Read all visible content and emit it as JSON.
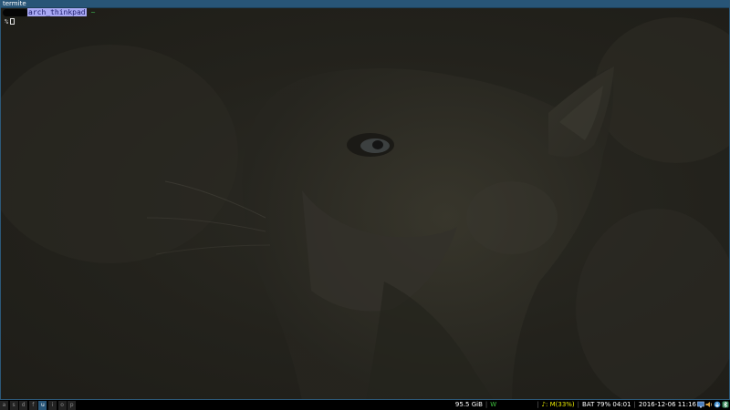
{
  "window": {
    "title": "termite"
  },
  "terminal": {
    "host": "arch_thinkpad",
    "cwd": "~",
    "prompt_symbol": "%"
  },
  "bar": {
    "workspaces": [
      {
        "label": "a",
        "focused": false
      },
      {
        "label": "s",
        "focused": false
      },
      {
        "label": "d",
        "focused": false
      },
      {
        "label": "f",
        "focused": false
      },
      {
        "label": "u",
        "focused": true
      },
      {
        "label": "i",
        "focused": false
      },
      {
        "label": "o",
        "focused": false
      },
      {
        "label": "p",
        "focused": false
      }
    ],
    "disk": "95.5 GiB",
    "wifi": "W",
    "volume": "♪: M(33%)",
    "battery": "BAT 79% 04:01",
    "datetime": "2016-12-06 11:16"
  },
  "tray": {
    "icons": [
      "network-manager-icon",
      "volume-icon",
      "update-icon",
      "bluetooth-icon"
    ]
  },
  "colors": {
    "titlebar": "#285577",
    "host_highlight": "#a9a9f4",
    "wifi_ok": "#3fc33f",
    "volume": "#e8e800"
  }
}
